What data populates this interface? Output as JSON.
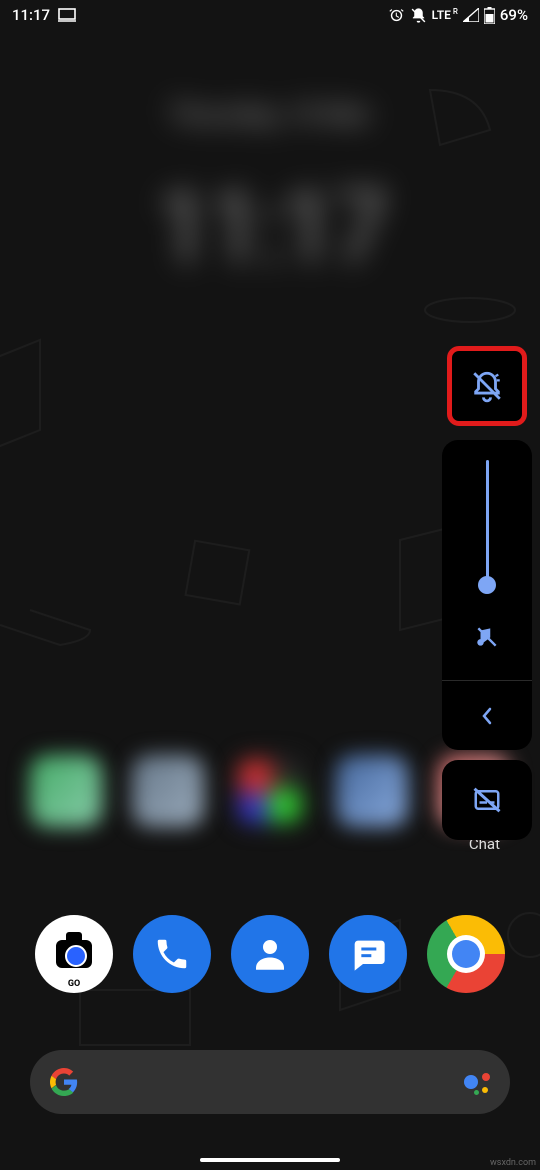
{
  "status_bar": {
    "time": "11:17",
    "lte_label": "LTE",
    "lte_roaming": "R",
    "battery_text": "69%"
  },
  "widget": {
    "date": "Thursday, 10 Mar",
    "time": "11:17"
  },
  "blurred_apps": {
    "chat_label": "Chat"
  },
  "dock": {
    "camera_sublabel": "GO"
  },
  "volume": {
    "level_percent": 10,
    "muted": true,
    "captions_off": true
  },
  "colors": {
    "accent": "#7ea6f5",
    "highlight_border": "#e11b1b",
    "dock_blue": "#2175e8"
  },
  "watermark": "wsxdn.com"
}
